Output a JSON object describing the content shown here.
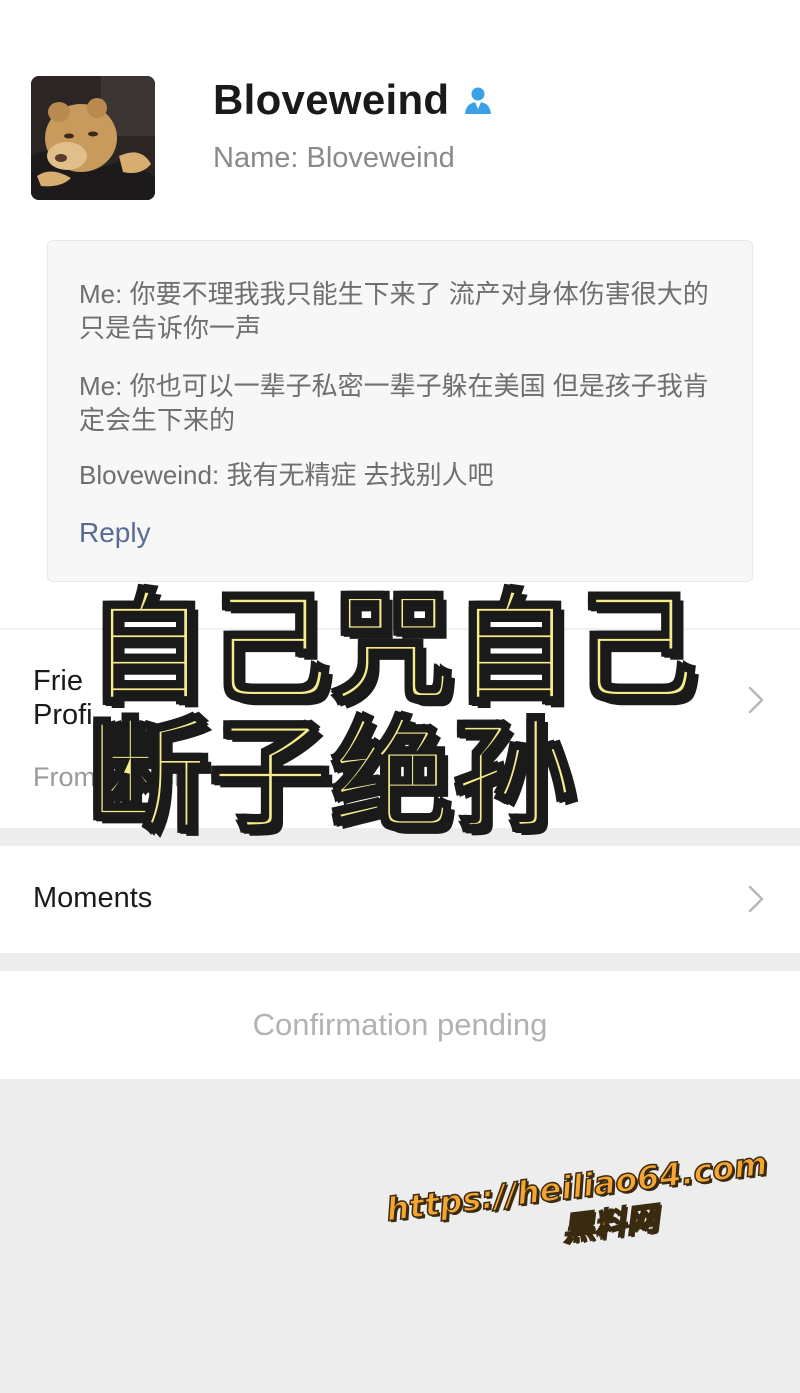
{
  "profile": {
    "display_name": "Bloveweind",
    "name_label": "Name:",
    "name_value": "Bloveweind",
    "contact_icon": "contact-person-icon",
    "avatar": "lion-cub-photo"
  },
  "messages": [
    {
      "sender": "Me:",
      "text": "你要不理我我只能生下来了 流产对身体伤害很大的 只是告诉你一声"
    },
    {
      "sender": "Me:",
      "text": "你也可以一辈子私密一辈子躲在美国  但是孩子我肯定会生下来的"
    },
    {
      "sender": "Bloveweind:",
      "text": "我有无精症 去找别人吧"
    }
  ],
  "reply_label": "Reply",
  "source": {
    "label_line1": "Frie",
    "label_line2": "Profi",
    "value": "From Search"
  },
  "moments": {
    "label": "Moments"
  },
  "status": {
    "text": "Confirmation pending"
  },
  "overlay": {
    "line1": "自己咒自己",
    "line2": "断子绝孙",
    "color": "#f6ec8a"
  },
  "watermark": {
    "url": "https://heiliao64.com",
    "name": "黑料网",
    "color": "#f5a531"
  },
  "colors": {
    "link": "#576b95",
    "icon_blue": "#3aa0e8",
    "gray_text": "#8a8a8a",
    "background_gap": "#ededed"
  }
}
